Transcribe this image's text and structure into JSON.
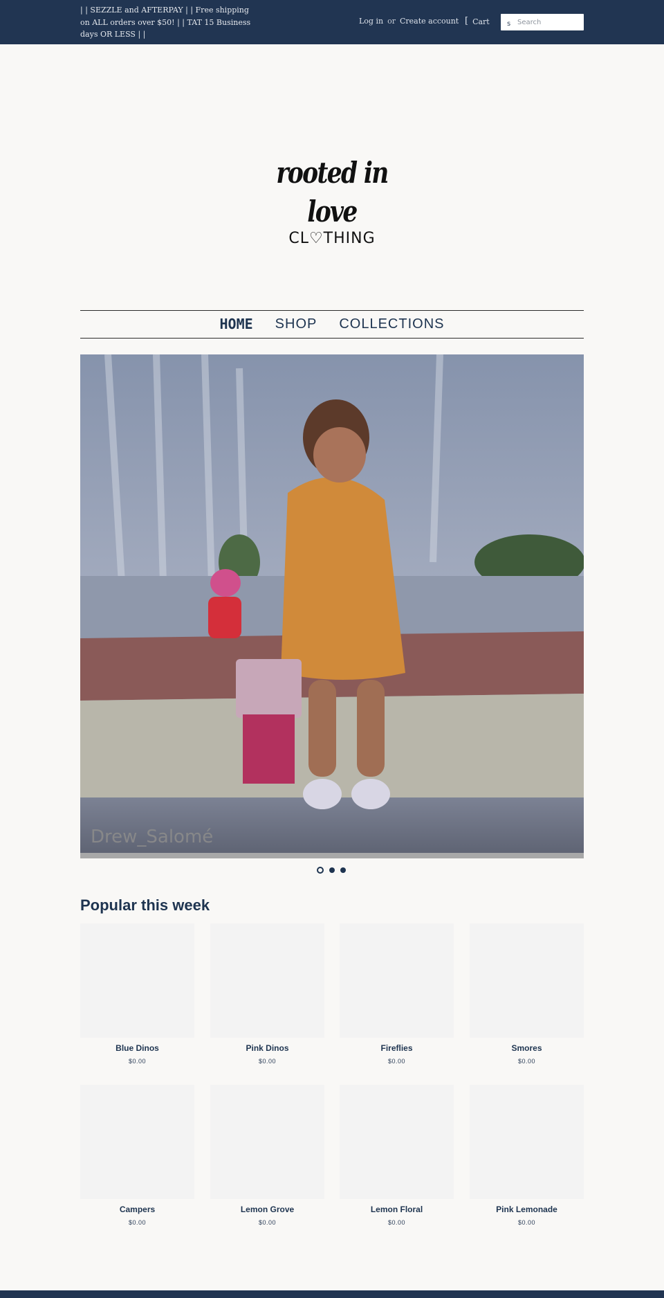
{
  "header": {
    "promo": "| | SEZZLE and AFTERPAY | | Free shipping on ALL orders over $50! | | TAT 15 Business days OR LESS | |",
    "login": "Log in",
    "or": "or",
    "create_account": "Create account",
    "cart_bracket": "[",
    "cart_label": "Cart",
    "search_icon": "s",
    "search_placeholder": "Search"
  },
  "logo": {
    "line1": "rooted in love",
    "line2": "CL♡THING"
  },
  "nav": {
    "items": [
      {
        "label": "HOME"
      },
      {
        "label": "SHOP"
      },
      {
        "label": "COLLECTIONS"
      }
    ]
  },
  "slideshow": {
    "watermark": "Drew_Salomé",
    "slide_count": 3,
    "active_index": 0
  },
  "popular": {
    "title": "Popular this week",
    "products": [
      {
        "name": "Blue Dinos",
        "price": "$0.00"
      },
      {
        "name": "Pink Dinos",
        "price": "$0.00"
      },
      {
        "name": "Fireflies",
        "price": "$0.00"
      },
      {
        "name": "Smores",
        "price": "$0.00"
      },
      {
        "name": "Campers",
        "price": "$0.00"
      },
      {
        "name": "Lemon Grove",
        "price": "$0.00"
      },
      {
        "name": "Lemon Floral",
        "price": "$0.00"
      },
      {
        "name": "Pink Lemonade",
        "price": "$0.00"
      }
    ]
  },
  "colors": {
    "header_bg": "#213552",
    "page_bg": "#f9f8f6",
    "text_navy": "#1e3450"
  }
}
